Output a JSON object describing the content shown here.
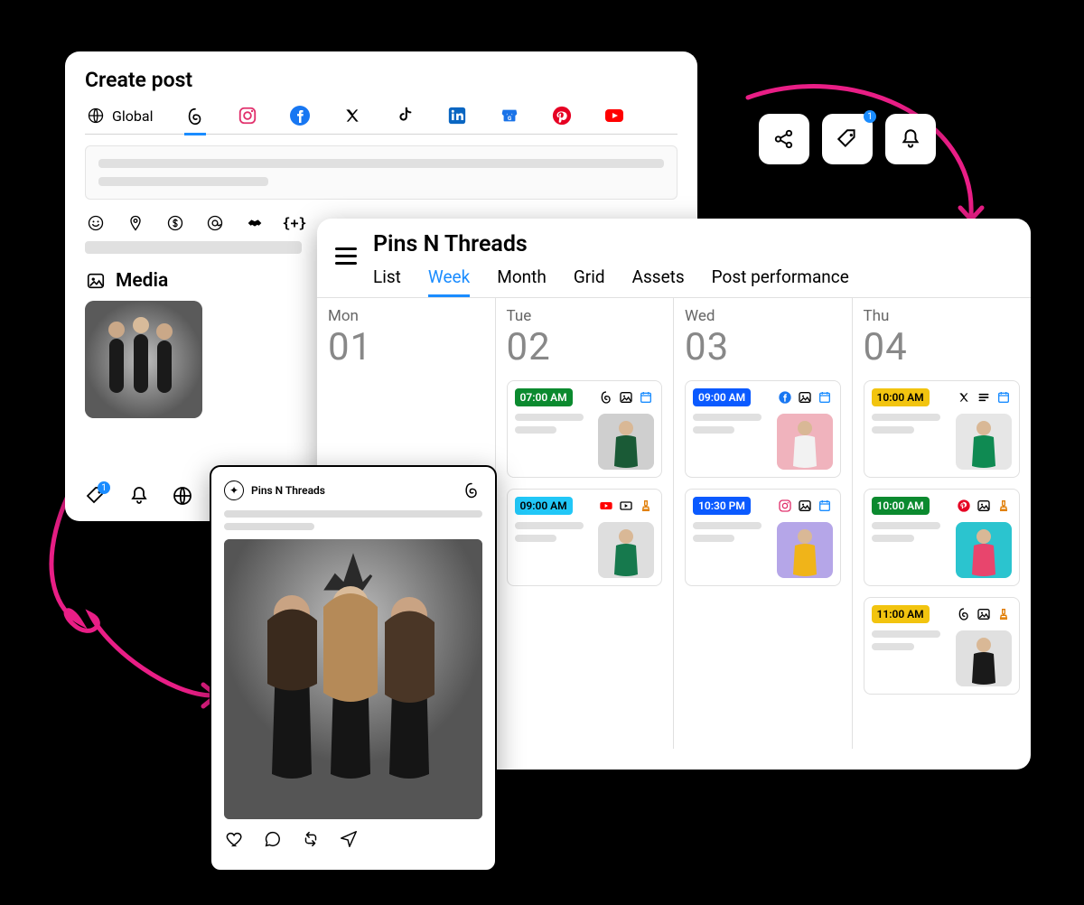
{
  "createPost": {
    "title": "Create post",
    "globalLabel": "Global",
    "mediaLabel": "Media",
    "tagBadge": "1"
  },
  "calendar": {
    "workspace": "Pins N Threads",
    "tabs": [
      "List",
      "Week",
      "Month",
      "Grid",
      "Assets",
      "Post performance"
    ],
    "activeTab": "Week",
    "days": [
      {
        "dow": "Mon",
        "num": "01",
        "posts": []
      },
      {
        "dow": "Tue",
        "num": "02",
        "posts": [
          {
            "time": "07:00 AM",
            "color": "green",
            "icons": [
              "threads",
              "image",
              "calendar"
            ],
            "thumbBg": "#cfcfcf",
            "dress": "#1a5a36"
          },
          {
            "time": "09:00 AM",
            "color": "cyan",
            "icons": [
              "youtube",
              "video",
              "stamp"
            ],
            "thumbBg": "#dedede",
            "dress": "#16794d"
          }
        ]
      },
      {
        "dow": "Wed",
        "num": "03",
        "posts": [
          {
            "time": "09:00 AM",
            "color": "blue",
            "icons": [
              "facebook",
              "image",
              "calendar"
            ],
            "thumbBg": "#f0b3bd",
            "dress": "#f2f2f2"
          },
          {
            "time": "10:30 PM",
            "color": "blue",
            "icons": [
              "instagram",
              "image",
              "calendar"
            ],
            "thumbBg": "#b5a6e8",
            "dress": "#f0b419"
          }
        ]
      },
      {
        "dow": "Thu",
        "num": "04",
        "posts": [
          {
            "time": "10:00 AM",
            "color": "yellow",
            "icons": [
              "x",
              "text",
              "calendar"
            ],
            "thumbBg": "#e6e6e6",
            "dress": "#0f8a52"
          },
          {
            "time": "10:00 AM",
            "color": "green",
            "icons": [
              "pinterest",
              "image",
              "stamp"
            ],
            "thumbBg": "#2bc4cf",
            "dress": "#e8456d"
          },
          {
            "time": "11:00 AM",
            "color": "yellow",
            "icons": [
              "threads",
              "image",
              "stamp"
            ],
            "thumbBg": "#e0e0e0",
            "dress": "#1a1a1a"
          }
        ]
      }
    ]
  },
  "preview": {
    "account": "Pins N Threads"
  },
  "tools": {
    "tagBadge": "1"
  },
  "colors": {
    "instagram": "#E1306C",
    "facebook": "#1877F2",
    "x": "#000",
    "tiktok": "#000",
    "linkedin": "#0A66C2",
    "gmb": "#1A73E8",
    "pinterest": "#E60023",
    "youtube": "#FF0000",
    "threads": "#000",
    "accent": "#1a8cff",
    "pinkArrow": "#e91e86"
  }
}
